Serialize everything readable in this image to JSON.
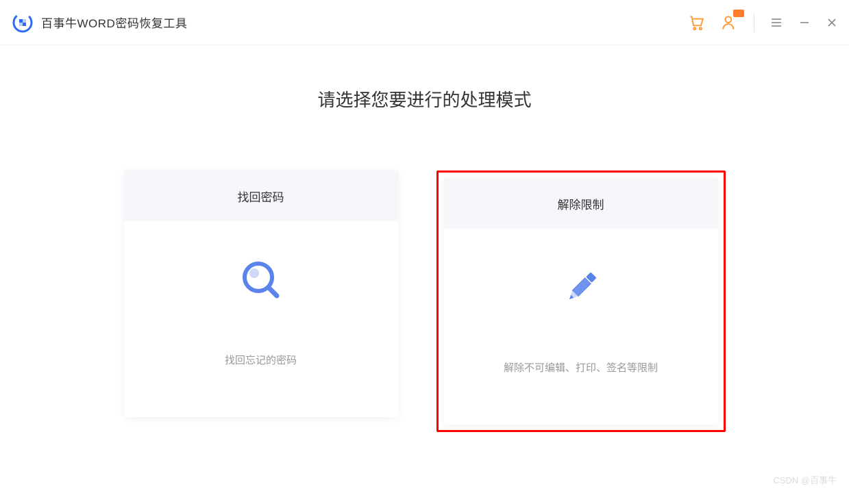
{
  "header": {
    "title": "百事牛WORD密码恢复工具"
  },
  "main": {
    "heading": "请选择您要进行的处理模式"
  },
  "cards": {
    "recover": {
      "title": "找回密码",
      "desc": "找回忘记的密码"
    },
    "remove": {
      "title": "解除限制",
      "desc": "解除不可编辑、打印、签名等限制"
    }
  },
  "watermark": "CSDN @百事牛"
}
